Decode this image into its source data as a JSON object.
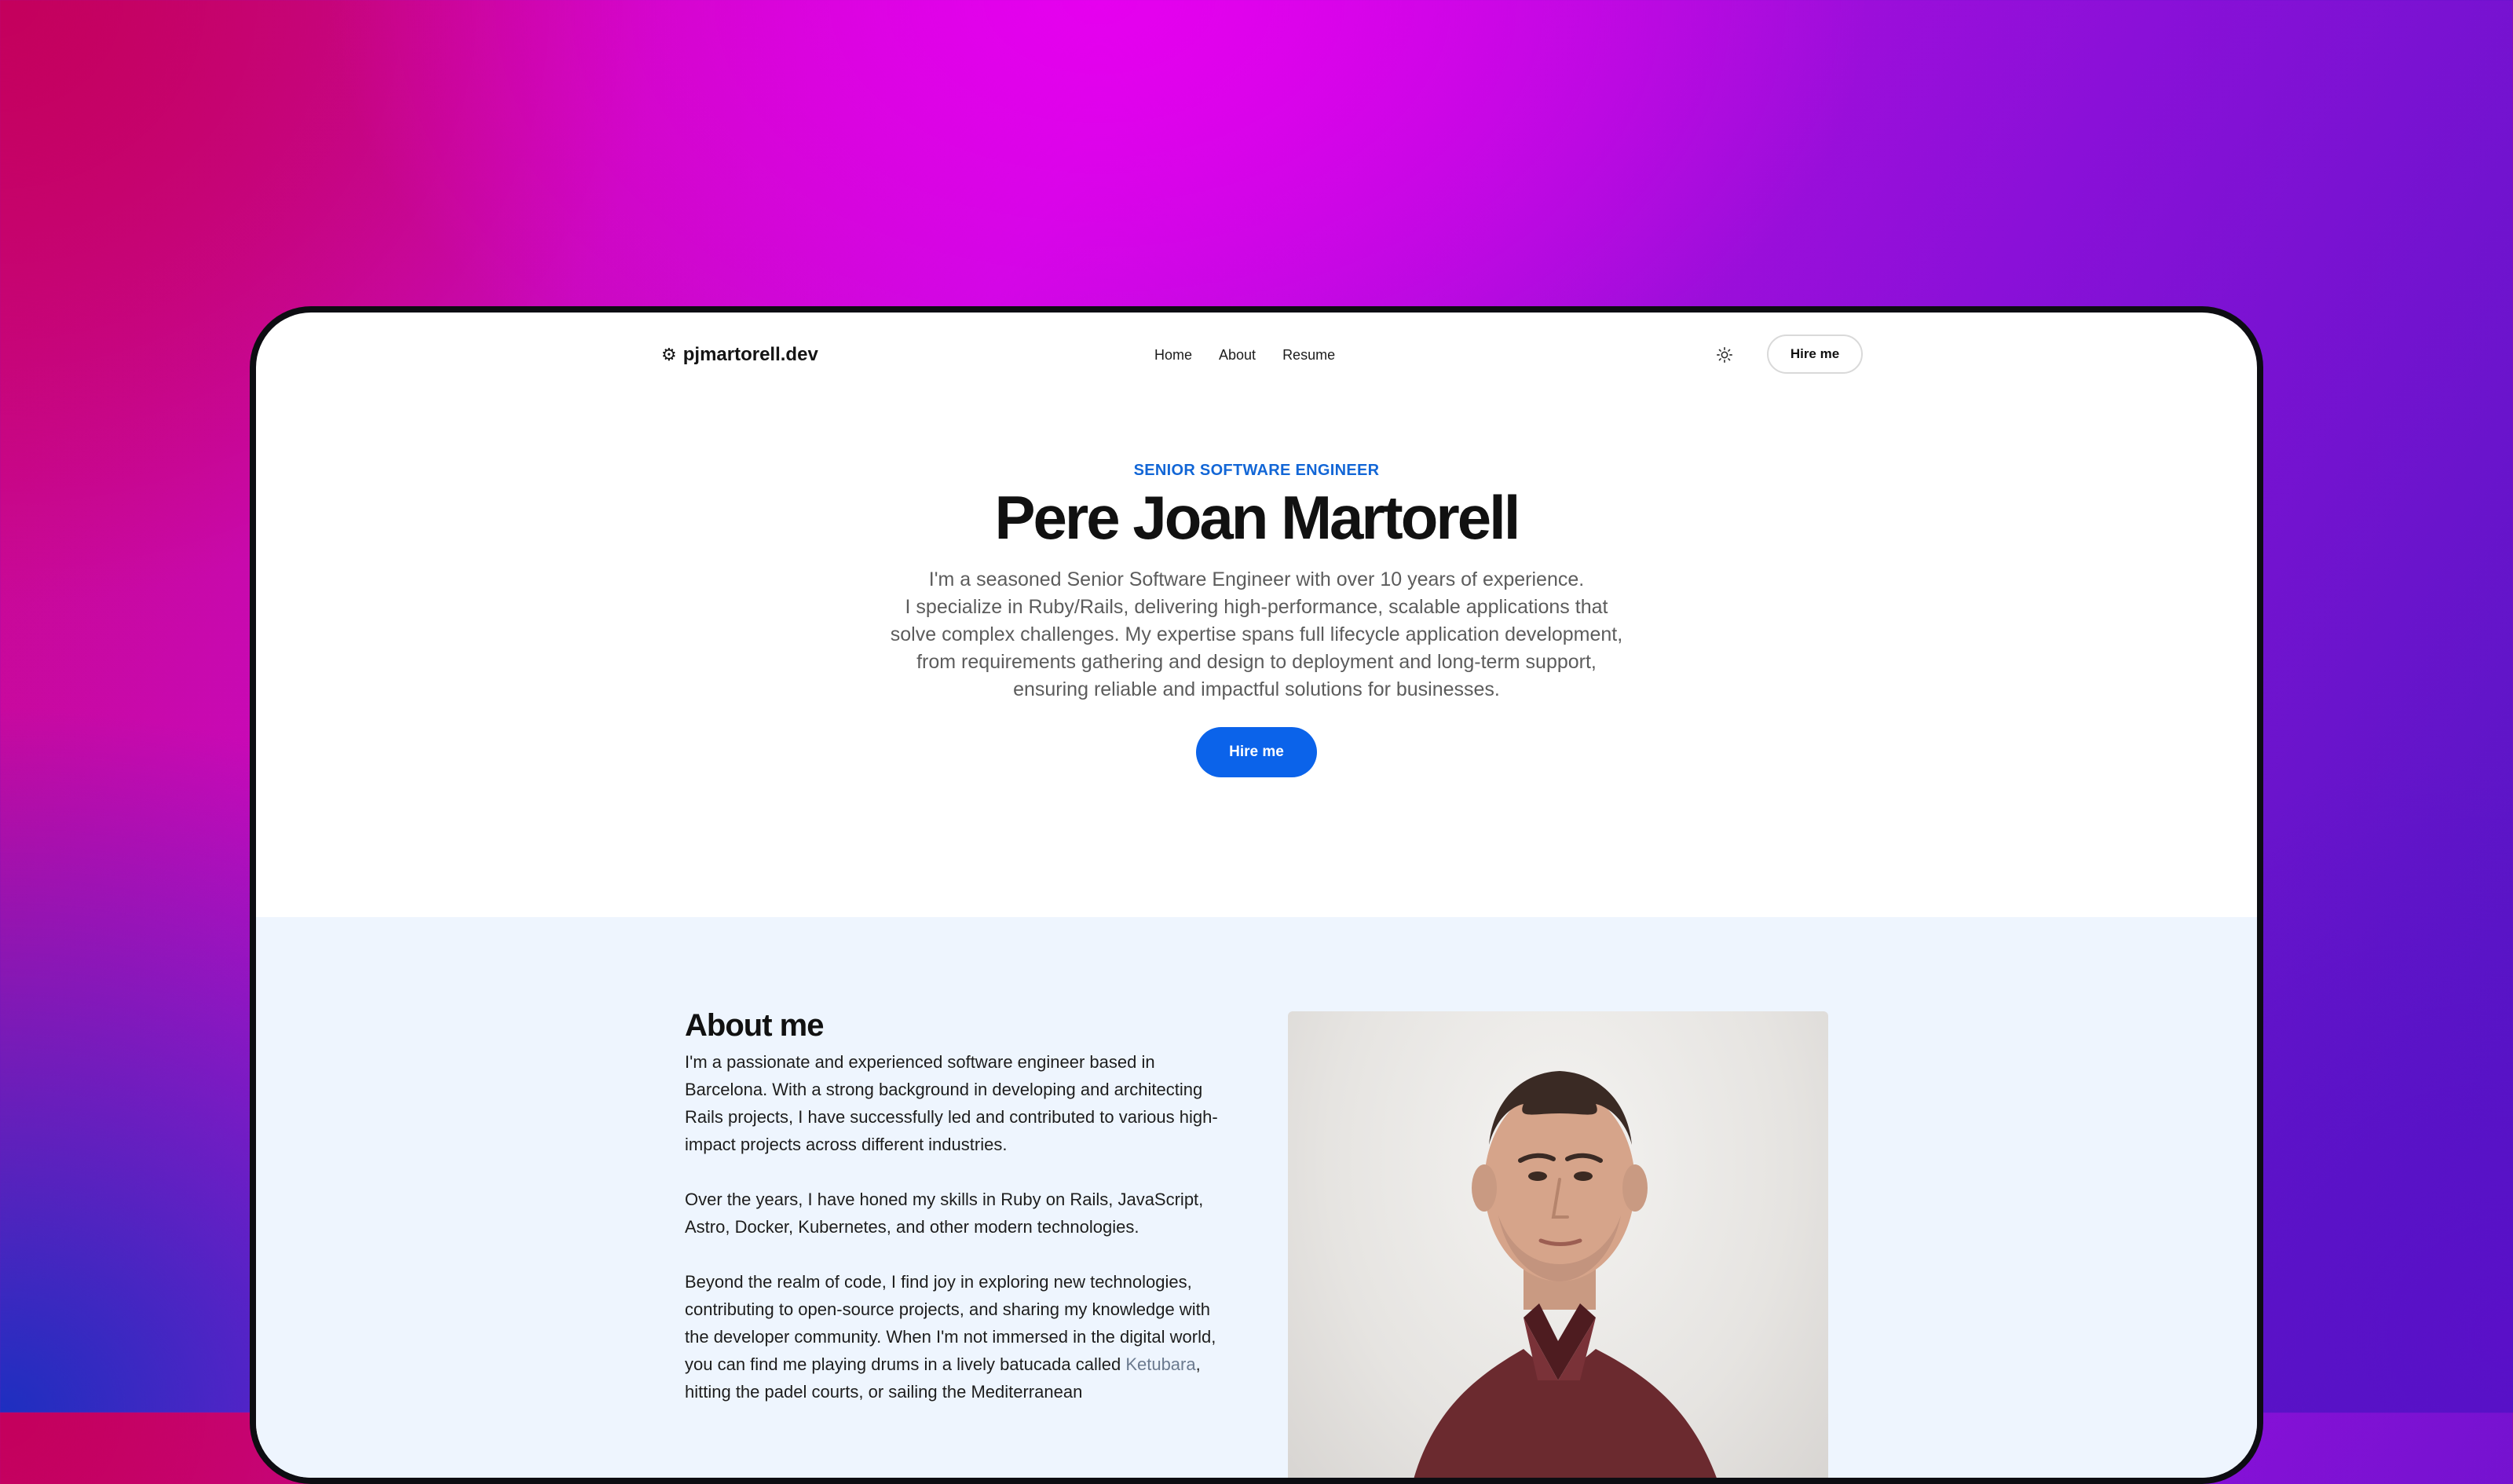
{
  "site": {
    "logo_icon": "gear-icon",
    "logo_text": "pjmartorell.dev"
  },
  "nav": {
    "items": [
      {
        "label": "Home"
      },
      {
        "label": "About"
      },
      {
        "label": "Resume"
      }
    ],
    "theme_icon": "sun-icon",
    "hire_label": "Hire me"
  },
  "hero": {
    "eyebrow": "SENIOR SOFTWARE ENGINEER",
    "title": "Pere Joan Martorell",
    "lines": [
      "I'm a seasoned Senior Software Engineer with over 10 years of experience.",
      "I specialize in Ruby/Rails, delivering high-performance, scalable applications that",
      "solve complex challenges. My expertise spans full lifecycle application development,",
      "from requirements gathering and design to deployment and long-term support,",
      "ensuring reliable and impactful solutions for businesses."
    ],
    "cta_label": "Hire me"
  },
  "about": {
    "title": "About me",
    "p1": "I'm a passionate and experienced software engineer based in Barcelona. With a strong background in developing and architecting Rails projects, I have successfully led and contributed to various high-impact projects across different industries.",
    "p2": "Over the years, I have honed my skills in Ruby on Rails, JavaScript, Astro, Docker, Kubernetes, and other modern technologies.",
    "p3_before": "Beyond the realm of code, I find joy in exploring new technologies, contributing to open-source projects, and sharing my knowledge with the developer community. When I'm not immersed in the digital world, you can find me playing drums in a lively batucada called ",
    "p3_link": "Ketubara",
    "p3_after": ", hitting the padel courts, or sailing the Mediterranean"
  },
  "colors": {
    "accent": "#0b63ea",
    "eyebrow": "#1266d6",
    "about_bg": "#eef5fe"
  }
}
